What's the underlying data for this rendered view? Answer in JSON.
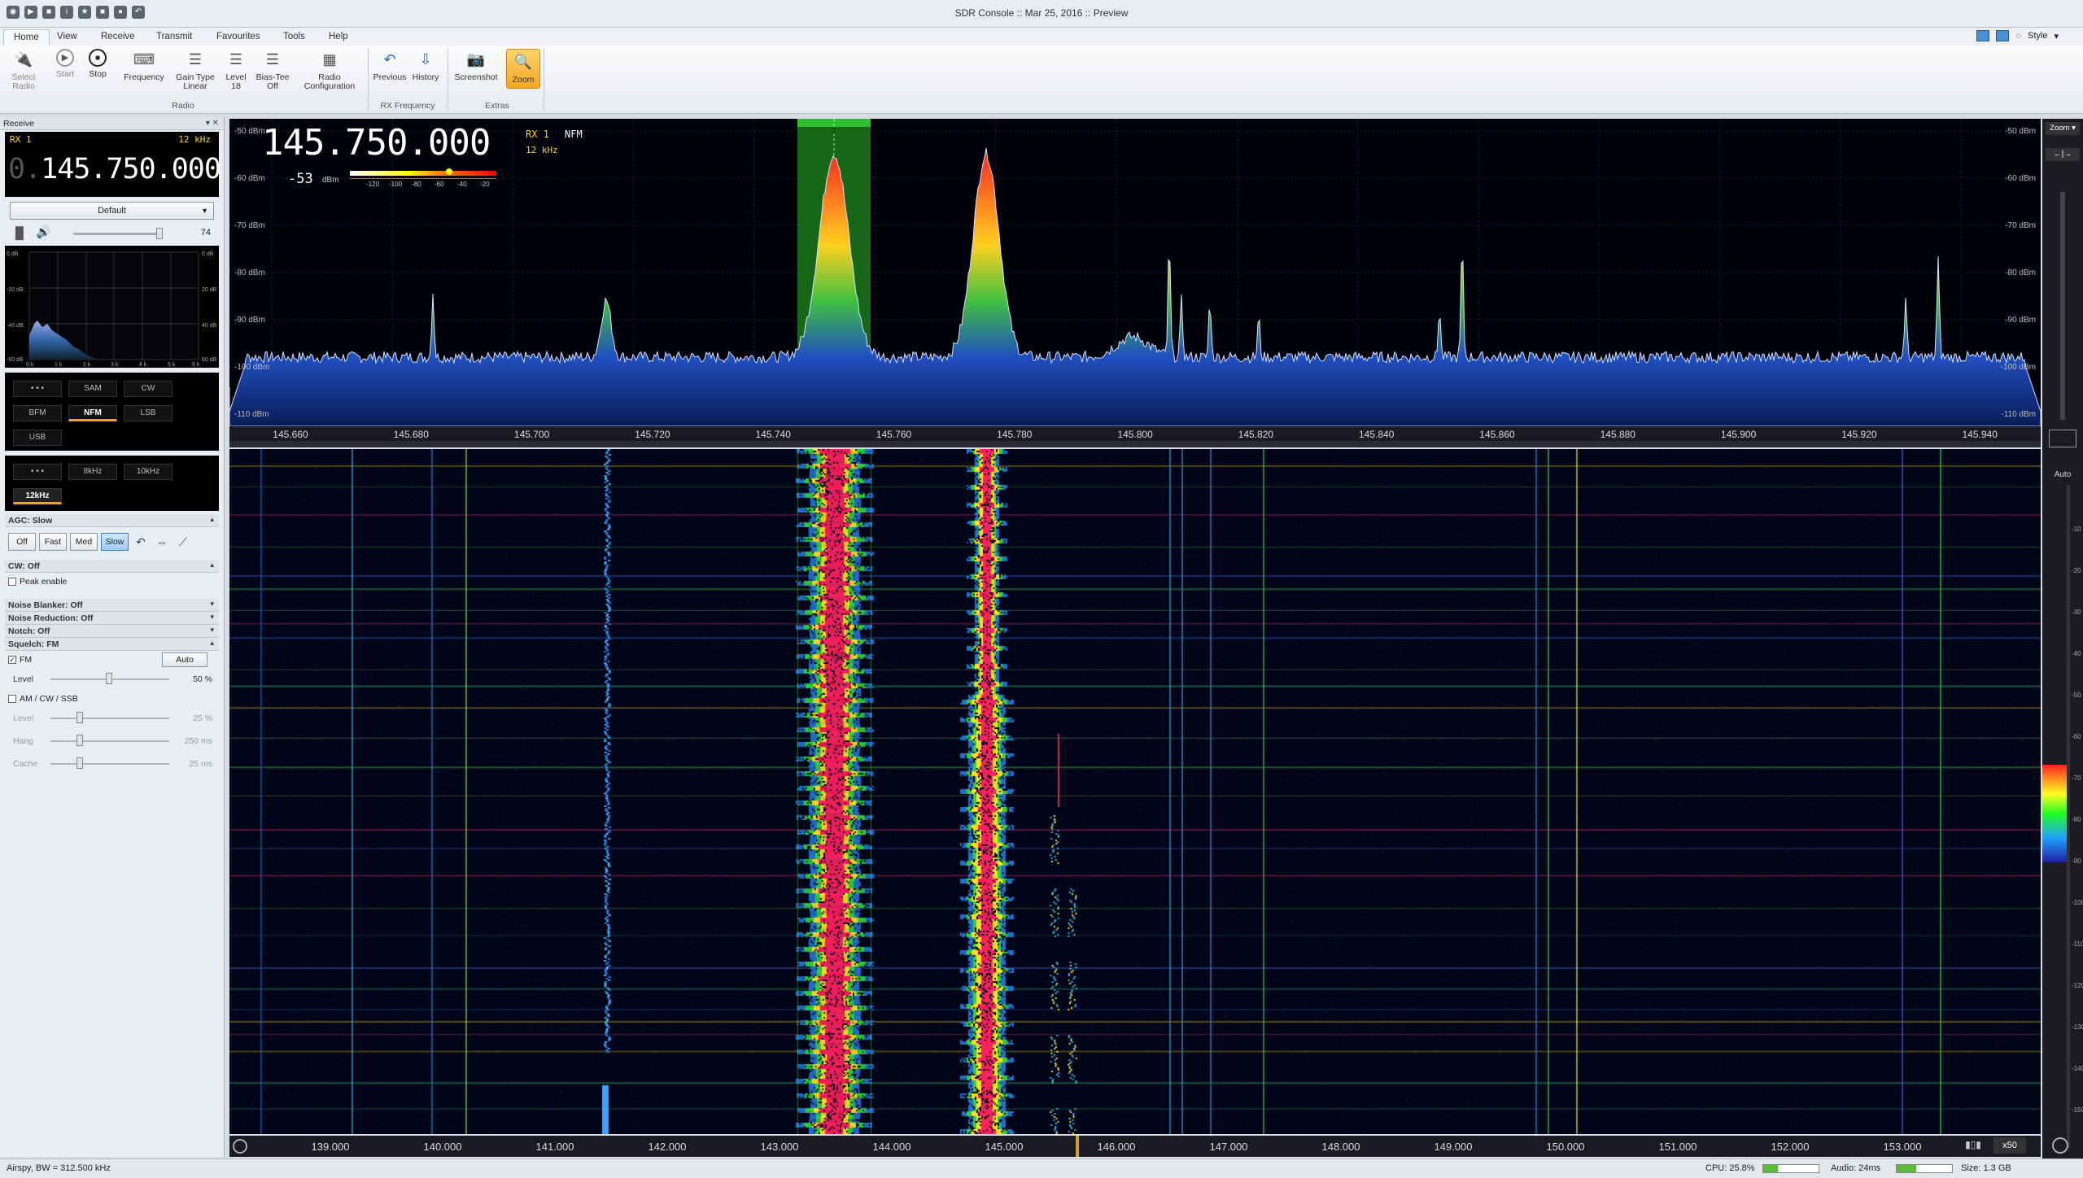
{
  "window": {
    "title": "SDR Console :: Mar 25, 2016 :: Preview"
  },
  "menu": {
    "tabs": [
      "Home",
      "View",
      "Receive",
      "Transmit",
      "Favourites",
      "Tools",
      "Help"
    ],
    "style_label": "Style"
  },
  "ribbon": {
    "buttons": [
      {
        "label": "Select\nRadio",
        "icon": "plug-icon"
      },
      {
        "label": "Start",
        "icon": "play-icon"
      },
      {
        "label": "Stop",
        "icon": "stop-icon"
      },
      {
        "label": "Frequency",
        "icon": "keyboard-icon"
      },
      {
        "label": "Gain Type\nLinear",
        "icon": "list-icon"
      },
      {
        "label": "Level\n18",
        "icon": "list-icon"
      },
      {
        "label": "Bias-Tee\nOff",
        "icon": "list-icon"
      },
      {
        "label": "Radio\nConfiguration",
        "icon": "settings-icon"
      },
      {
        "label": "Previous",
        "icon": "undo-icon"
      },
      {
        "label": "History",
        "icon": "history-icon"
      },
      {
        "label": "Screenshot",
        "icon": "camera-icon"
      },
      {
        "label": "Zoom",
        "icon": "zoom-icon"
      }
    ],
    "groups": [
      "Radio",
      "RX Frequency",
      "Extras"
    ]
  },
  "receive": {
    "panel_title": "Receive",
    "rx_label": "RX 1",
    "bandwidth": "12 kHz",
    "frequency_dim": "0.",
    "frequency": "145.750.000",
    "preset": "Default",
    "volume": "74",
    "audio_axis": {
      "left": [
        "0 dB",
        "-20 dB",
        "-40 dB",
        "-60 dB"
      ],
      "right": [
        "0 dB",
        "20 dB",
        "40 dB",
        "60 dB"
      ],
      "x": [
        "0 k",
        "1 k",
        "2 k",
        "3 k",
        "4 k",
        "5 k",
        "6 k"
      ]
    },
    "modes": [
      "• • •",
      "SAM",
      "CW",
      "BFM",
      "NFM",
      "LSB",
      "USB"
    ],
    "selected_mode": "NFM",
    "bandwidths": [
      "• • •",
      "8kHz",
      "10kHz",
      "12kHz"
    ],
    "selected_bandwidth": "12kHz",
    "agc": {
      "title": "AGC: Slow",
      "options": [
        "Off",
        "Fast",
        "Med",
        "Slow"
      ],
      "selected": "Slow"
    },
    "cw": {
      "title": "CW: Off",
      "peak": "Peak enable"
    },
    "noise_blanker": "Noise Blanker: Off",
    "noise_reduction": "Noise Reduction: Off",
    "notch": "Notch: Off",
    "squelch": {
      "title": "Squelch: FM",
      "fm_label": "FM",
      "auto_label": "Auto",
      "level_label": "Level",
      "level_value": "50 %",
      "am_label": "AM / CW / SSB",
      "am_level_label": "Level",
      "am_level_value": "25 %",
      "hang_label": "Hang",
      "hang_value": "250 ms",
      "cache_label": "Cache",
      "cache_value": "25 ms"
    }
  },
  "spectrum": {
    "frequency": "145.750.000",
    "rx": "RX 1",
    "mode": "NFM",
    "bandwidth": "12 kHz",
    "level": "-53",
    "level_unit": "dBm",
    "meter_scale": [
      "-120",
      "-100",
      "-80",
      "-60",
      "-40",
      "-20"
    ],
    "db_labels": [
      "-50 dBm",
      "-60 dBm",
      "-70 dBm",
      "-80 dBm",
      "-90 dBm",
      "-100 dBm",
      "-110 dBm"
    ],
    "freq_labels": [
      "145.660",
      "145.680",
      "145.700",
      "145.720",
      "145.740",
      "145.760",
      "145.780",
      "145.800",
      "145.820",
      "145.840",
      "145.860",
      "145.880",
      "145.900",
      "145.920",
      "145.940"
    ],
    "marker": "1",
    "zoom_label": "Zoom ▾"
  },
  "waterfall": {
    "freq_labels": [
      "139.000",
      "140.000",
      "141.000",
      "142.000",
      "143.000",
      "144.000",
      "145.000",
      "146.000",
      "147.000",
      "148.000",
      "149.000",
      "150.000",
      "151.000",
      "152.000",
      "153.000"
    ],
    "auto_label": "Auto",
    "scale_labels": [
      "-10",
      "-20",
      "-30",
      "-40",
      "-50",
      "-60",
      "-70",
      "-80",
      "-90",
      "-100",
      "-110",
      "-120",
      "-130",
      "-140",
      "-150"
    ],
    "speed": "x50"
  },
  "status": {
    "left": "Airspy, BW = 312.500 kHz",
    "cpu": "CPU: 25.8%",
    "cpu_level": 0.26,
    "audio": "Audio: 24ms",
    "audio_level": 0.35,
    "size": "Size: 1.3 GB"
  }
}
